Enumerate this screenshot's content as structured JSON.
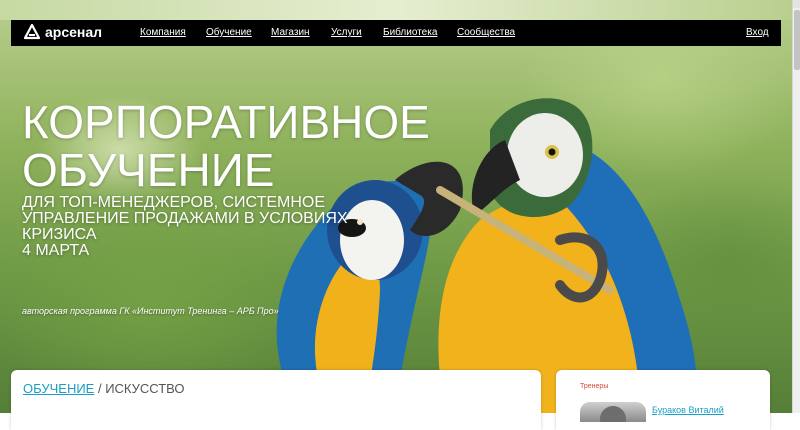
{
  "header": {
    "logo_text": "арсенал",
    "logo_icon": "triangle-arrow-icon",
    "nav": [
      "Компания",
      "Обучение",
      "Магазин",
      "Услуги",
      "Библиотека",
      "Сообщества"
    ],
    "login": "Вход"
  },
  "hero": {
    "title_line1": "КОРПОРАТИВНОЕ",
    "title_line2": "ОБУЧЕНИЕ",
    "subtitle_line1": "ДЛЯ ТОП-МЕНЕДЖЕРОВ, СИСТЕМНОЕ",
    "subtitle_line2": "УПРАВЛЕНИЕ ПРОДАЖАМИ В УСЛОВИЯХ",
    "subtitle_line3": "КРИЗИСА",
    "subtitle_line4": "4 МАРТА",
    "author": "авторская программа ГК «Институт Тренинга – АРБ Про»",
    "image_subject": "parrots-macaws-photo"
  },
  "breadcrumb": {
    "link": "ОБУЧЕНИЕ",
    "separator": " / ",
    "current": "ИСКУССТВО"
  },
  "sidebar": {
    "title": "Тренеры",
    "trainer_name": "Бураков Виталий"
  },
  "colors": {
    "navbar": "#000000",
    "link": "#1a9ec9",
    "accent_red": "#d54a3a"
  }
}
